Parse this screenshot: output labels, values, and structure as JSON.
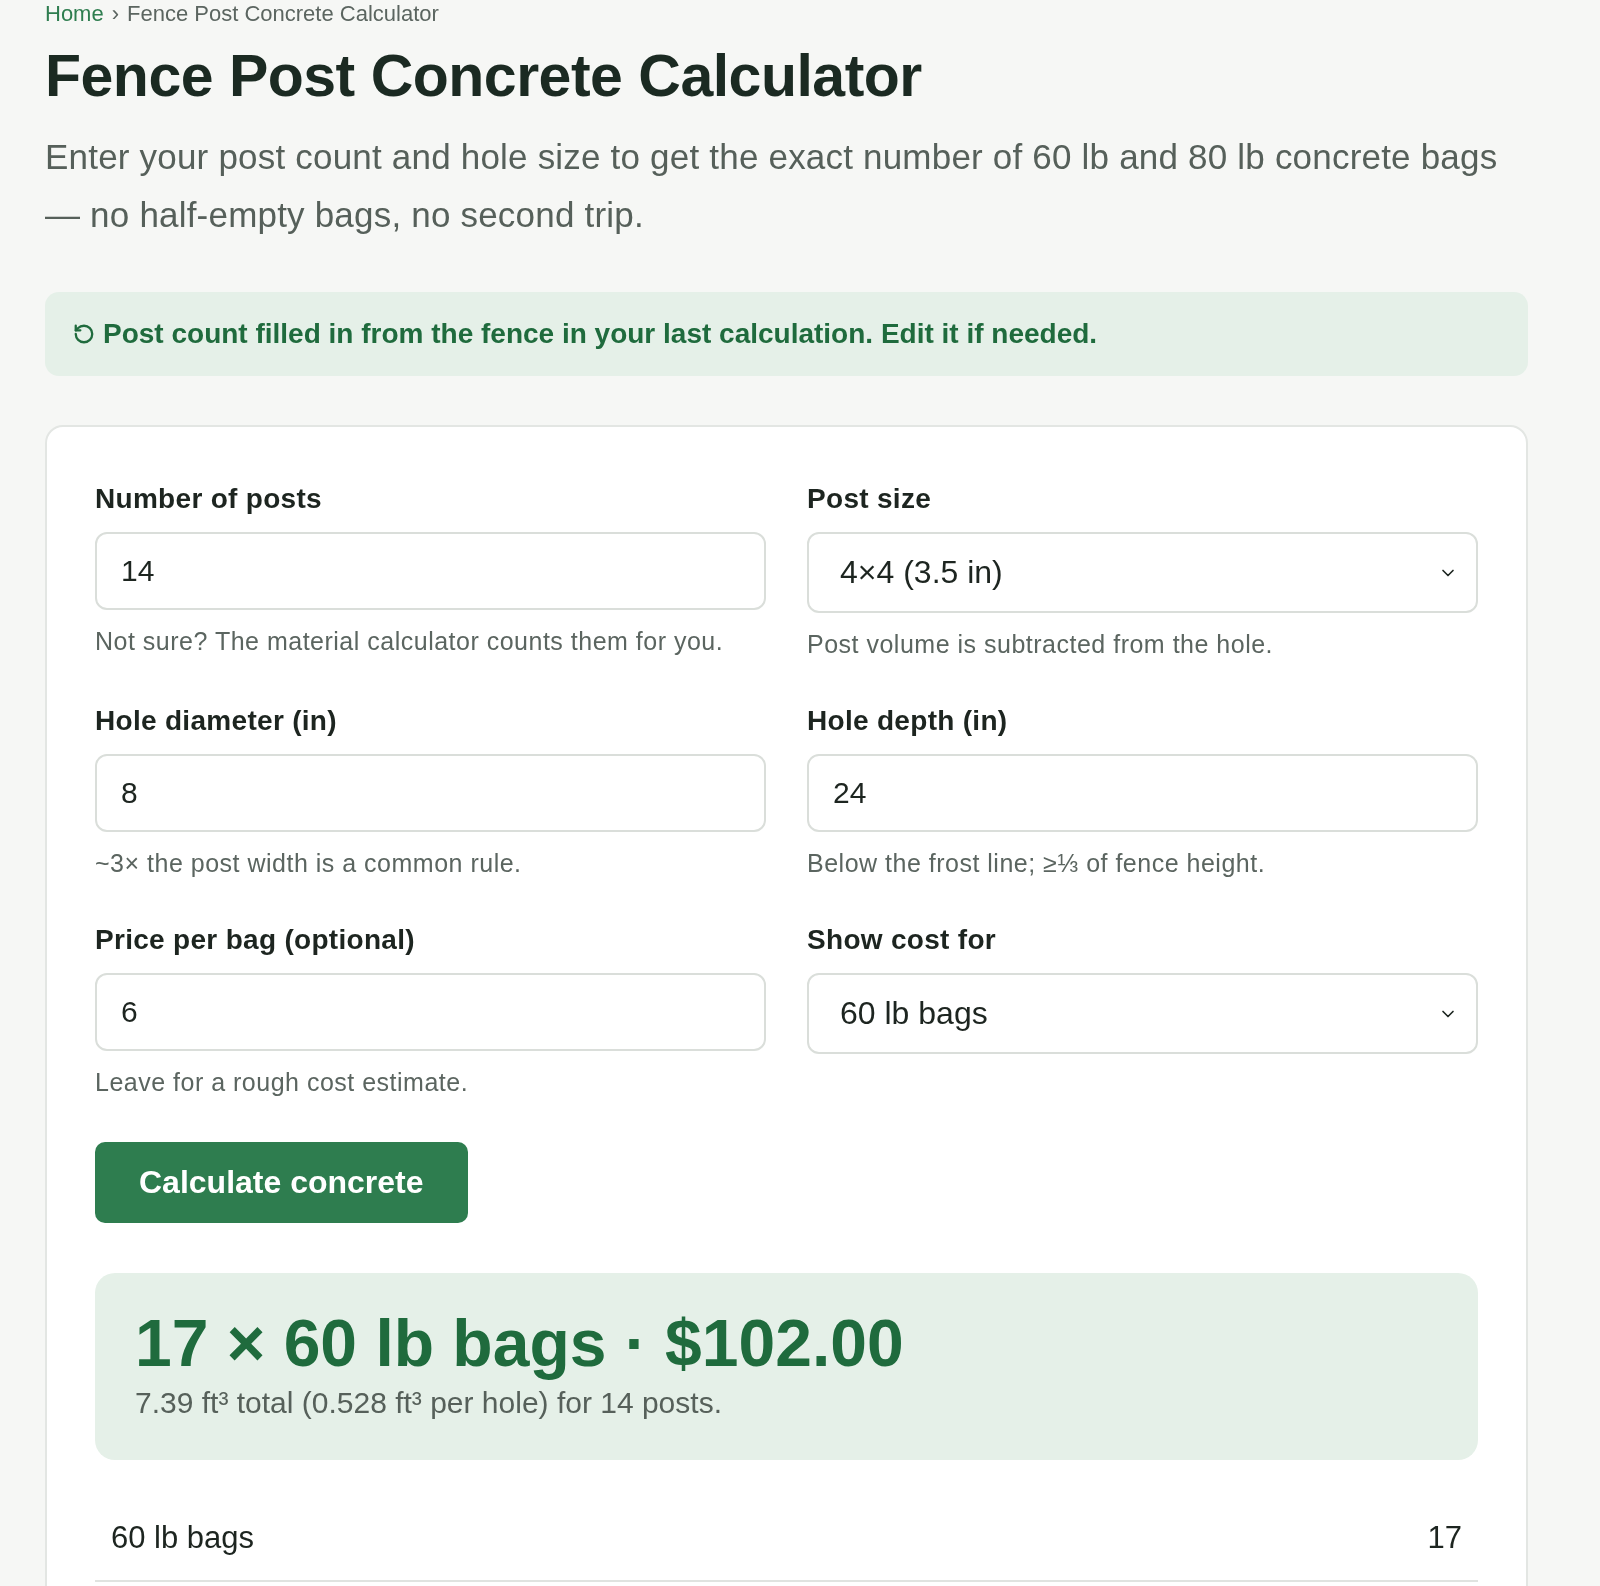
{
  "breadcrumb": {
    "home": "Home",
    "separator": "›",
    "current": "Fence Post Concrete Calculator"
  },
  "title": "Fence Post Concrete Calculator",
  "subtitle": "Enter your post count and hole size to get the exact number of 60 lb and 80 lb concrete bags — no half-empty bags, no second trip.",
  "notice": {
    "text": "Post count filled in from the fence in your last calculation. Edit it if needed."
  },
  "form": {
    "fields": [
      {
        "kind": "input",
        "label": "Number of posts",
        "value": "14",
        "help": "Not sure? The material calculator counts them for you."
      },
      {
        "kind": "select",
        "label": "Post size",
        "value": "4×4 (3.5 in)",
        "help": "Post volume is subtracted from the hole."
      },
      {
        "kind": "input",
        "label": "Hole diameter (in)",
        "value": "8",
        "help": "~3× the post width is a common rule."
      },
      {
        "kind": "input",
        "label": "Hole depth (in)",
        "value": "24",
        "help": "Below the frost line; ≥⅓ of fence height."
      },
      {
        "kind": "input",
        "label": "Price per bag (optional)",
        "value": "6",
        "help": "Leave for a rough cost estimate."
      },
      {
        "kind": "select",
        "label": "Show cost for",
        "value": "60 lb bags"
      }
    ]
  },
  "button": {
    "label": "Calculate concrete"
  },
  "result": {
    "headline": "17 × 60 lb bags · $102.00",
    "detail": "7.39 ft³ total (0.528 ft³ per hole) for 14 posts."
  },
  "breakdown": [
    {
      "label": "60 lb bags",
      "value": "17"
    }
  ]
}
